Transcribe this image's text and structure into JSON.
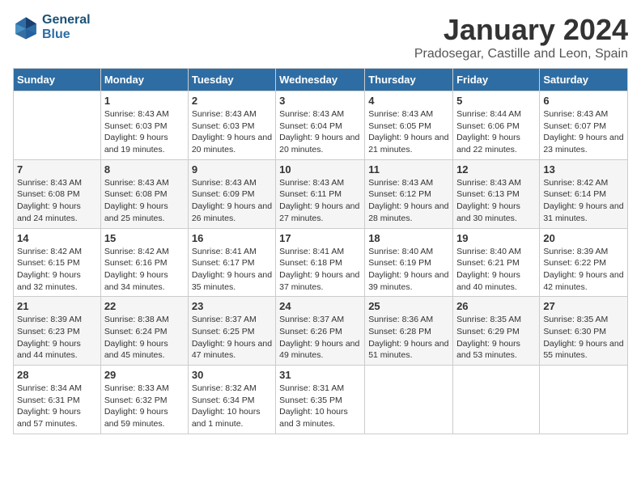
{
  "logo": {
    "text1": "General",
    "text2": "Blue"
  },
  "title": "January 2024",
  "subtitle": "Pradosegar, Castille and Leon, Spain",
  "days_of_week": [
    "Sunday",
    "Monday",
    "Tuesday",
    "Wednesday",
    "Thursday",
    "Friday",
    "Saturday"
  ],
  "weeks": [
    [
      {
        "day": "",
        "sunrise": "",
        "sunset": "",
        "daylight": ""
      },
      {
        "day": "1",
        "sunrise": "Sunrise: 8:43 AM",
        "sunset": "Sunset: 6:03 PM",
        "daylight": "Daylight: 9 hours and 19 minutes."
      },
      {
        "day": "2",
        "sunrise": "Sunrise: 8:43 AM",
        "sunset": "Sunset: 6:03 PM",
        "daylight": "Daylight: 9 hours and 20 minutes."
      },
      {
        "day": "3",
        "sunrise": "Sunrise: 8:43 AM",
        "sunset": "Sunset: 6:04 PM",
        "daylight": "Daylight: 9 hours and 20 minutes."
      },
      {
        "day": "4",
        "sunrise": "Sunrise: 8:43 AM",
        "sunset": "Sunset: 6:05 PM",
        "daylight": "Daylight: 9 hours and 21 minutes."
      },
      {
        "day": "5",
        "sunrise": "Sunrise: 8:44 AM",
        "sunset": "Sunset: 6:06 PM",
        "daylight": "Daylight: 9 hours and 22 minutes."
      },
      {
        "day": "6",
        "sunrise": "Sunrise: 8:43 AM",
        "sunset": "Sunset: 6:07 PM",
        "daylight": "Daylight: 9 hours and 23 minutes."
      }
    ],
    [
      {
        "day": "7",
        "sunrise": "Sunrise: 8:43 AM",
        "sunset": "Sunset: 6:08 PM",
        "daylight": "Daylight: 9 hours and 24 minutes."
      },
      {
        "day": "8",
        "sunrise": "Sunrise: 8:43 AM",
        "sunset": "Sunset: 6:08 PM",
        "daylight": "Daylight: 9 hours and 25 minutes."
      },
      {
        "day": "9",
        "sunrise": "Sunrise: 8:43 AM",
        "sunset": "Sunset: 6:09 PM",
        "daylight": "Daylight: 9 hours and 26 minutes."
      },
      {
        "day": "10",
        "sunrise": "Sunrise: 8:43 AM",
        "sunset": "Sunset: 6:11 PM",
        "daylight": "Daylight: 9 hours and 27 minutes."
      },
      {
        "day": "11",
        "sunrise": "Sunrise: 8:43 AM",
        "sunset": "Sunset: 6:12 PM",
        "daylight": "Daylight: 9 hours and 28 minutes."
      },
      {
        "day": "12",
        "sunrise": "Sunrise: 8:43 AM",
        "sunset": "Sunset: 6:13 PM",
        "daylight": "Daylight: 9 hours and 30 minutes."
      },
      {
        "day": "13",
        "sunrise": "Sunrise: 8:42 AM",
        "sunset": "Sunset: 6:14 PM",
        "daylight": "Daylight: 9 hours and 31 minutes."
      }
    ],
    [
      {
        "day": "14",
        "sunrise": "Sunrise: 8:42 AM",
        "sunset": "Sunset: 6:15 PM",
        "daylight": "Daylight: 9 hours and 32 minutes."
      },
      {
        "day": "15",
        "sunrise": "Sunrise: 8:42 AM",
        "sunset": "Sunset: 6:16 PM",
        "daylight": "Daylight: 9 hours and 34 minutes."
      },
      {
        "day": "16",
        "sunrise": "Sunrise: 8:41 AM",
        "sunset": "Sunset: 6:17 PM",
        "daylight": "Daylight: 9 hours and 35 minutes."
      },
      {
        "day": "17",
        "sunrise": "Sunrise: 8:41 AM",
        "sunset": "Sunset: 6:18 PM",
        "daylight": "Daylight: 9 hours and 37 minutes."
      },
      {
        "day": "18",
        "sunrise": "Sunrise: 8:40 AM",
        "sunset": "Sunset: 6:19 PM",
        "daylight": "Daylight: 9 hours and 39 minutes."
      },
      {
        "day": "19",
        "sunrise": "Sunrise: 8:40 AM",
        "sunset": "Sunset: 6:21 PM",
        "daylight": "Daylight: 9 hours and 40 minutes."
      },
      {
        "day": "20",
        "sunrise": "Sunrise: 8:39 AM",
        "sunset": "Sunset: 6:22 PM",
        "daylight": "Daylight: 9 hours and 42 minutes."
      }
    ],
    [
      {
        "day": "21",
        "sunrise": "Sunrise: 8:39 AM",
        "sunset": "Sunset: 6:23 PM",
        "daylight": "Daylight: 9 hours and 44 minutes."
      },
      {
        "day": "22",
        "sunrise": "Sunrise: 8:38 AM",
        "sunset": "Sunset: 6:24 PM",
        "daylight": "Daylight: 9 hours and 45 minutes."
      },
      {
        "day": "23",
        "sunrise": "Sunrise: 8:37 AM",
        "sunset": "Sunset: 6:25 PM",
        "daylight": "Daylight: 9 hours and 47 minutes."
      },
      {
        "day": "24",
        "sunrise": "Sunrise: 8:37 AM",
        "sunset": "Sunset: 6:26 PM",
        "daylight": "Daylight: 9 hours and 49 minutes."
      },
      {
        "day": "25",
        "sunrise": "Sunrise: 8:36 AM",
        "sunset": "Sunset: 6:28 PM",
        "daylight": "Daylight: 9 hours and 51 minutes."
      },
      {
        "day": "26",
        "sunrise": "Sunrise: 8:35 AM",
        "sunset": "Sunset: 6:29 PM",
        "daylight": "Daylight: 9 hours and 53 minutes."
      },
      {
        "day": "27",
        "sunrise": "Sunrise: 8:35 AM",
        "sunset": "Sunset: 6:30 PM",
        "daylight": "Daylight: 9 hours and 55 minutes."
      }
    ],
    [
      {
        "day": "28",
        "sunrise": "Sunrise: 8:34 AM",
        "sunset": "Sunset: 6:31 PM",
        "daylight": "Daylight: 9 hours and 57 minutes."
      },
      {
        "day": "29",
        "sunrise": "Sunrise: 8:33 AM",
        "sunset": "Sunset: 6:32 PM",
        "daylight": "Daylight: 9 hours and 59 minutes."
      },
      {
        "day": "30",
        "sunrise": "Sunrise: 8:32 AM",
        "sunset": "Sunset: 6:34 PM",
        "daylight": "Daylight: 10 hours and 1 minute."
      },
      {
        "day": "31",
        "sunrise": "Sunrise: 8:31 AM",
        "sunset": "Sunset: 6:35 PM",
        "daylight": "Daylight: 10 hours and 3 minutes."
      },
      {
        "day": "",
        "sunrise": "",
        "sunset": "",
        "daylight": ""
      },
      {
        "day": "",
        "sunrise": "",
        "sunset": "",
        "daylight": ""
      },
      {
        "day": "",
        "sunrise": "",
        "sunset": "",
        "daylight": ""
      }
    ]
  ]
}
